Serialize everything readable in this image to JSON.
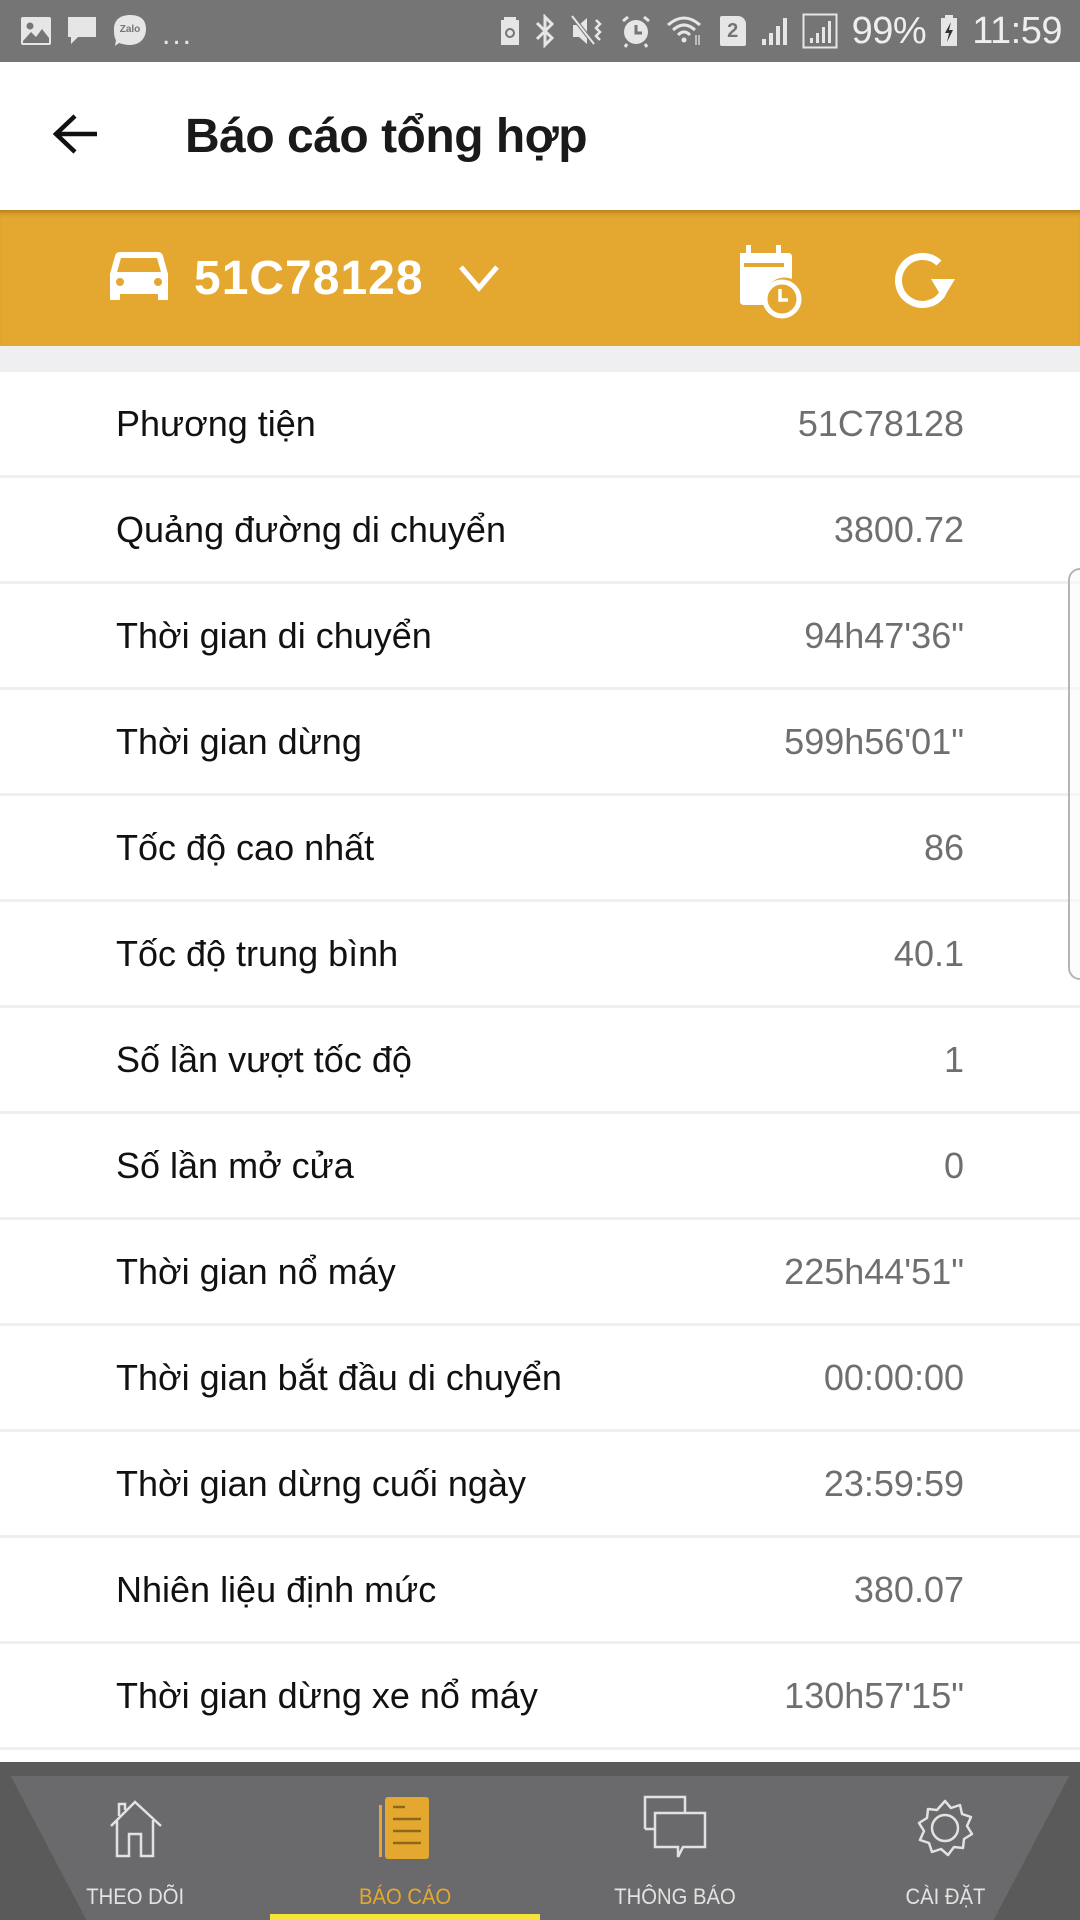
{
  "status_bar": {
    "left_icons": [
      "gallery-icon",
      "message-icon",
      "zalo-icon"
    ],
    "zalo_label": "Zalo",
    "more_indicator": "...",
    "right_icons": [
      "storage-icon",
      "bluetooth-icon",
      "vibrate-mute-icon",
      "alarm-icon",
      "wifi-icon",
      "sim2-icon",
      "signal-icon",
      "signal-icon-2"
    ],
    "sim_number": "2",
    "battery_percent": "99%",
    "time": "11:59"
  },
  "app_bar": {
    "back_icon": "arrow-left-icon",
    "title": "Báo cáo tổng hợp"
  },
  "vehicle_bar": {
    "vehicle_icon": "car-icon",
    "selected_vehicle": "51C78128",
    "dropdown_icon": "chevron-down-icon",
    "calendar_icon": "calendar-clock-icon",
    "refresh_icon": "refresh-icon",
    "accent_color": "#e4a830"
  },
  "report": {
    "rows": [
      {
        "label": "Phương tiện",
        "value": "51C78128"
      },
      {
        "label": "Quảng đường di chuyển",
        "value": "3800.72"
      },
      {
        "label": "Thời gian di chuyển",
        "value": "94h47'36\""
      },
      {
        "label": "Thời gian dừng",
        "value": "599h56'01\""
      },
      {
        "label": "Tốc độ cao nhất",
        "value": "86"
      },
      {
        "label": "Tốc độ trung bình",
        "value": "40.1"
      },
      {
        "label": "Số lần vượt tốc độ",
        "value": "1"
      },
      {
        "label": "Số lần mở cửa",
        "value": "0"
      },
      {
        "label": "Thời gian nổ máy",
        "value": "225h44'51\""
      },
      {
        "label": "Thời gian bắt đầu di chuyển",
        "value": "00:00:00"
      },
      {
        "label": "Thời gian dừng cuối ngày",
        "value": "23:59:59"
      },
      {
        "label": "Nhiên liệu định mức",
        "value": "380.07"
      },
      {
        "label": "Thời gian dừng xe nổ máy",
        "value": "130h57'15\""
      }
    ]
  },
  "bottom_nav": {
    "items": [
      {
        "label": "THEO DÕI",
        "icon": "home-icon",
        "active": false
      },
      {
        "label": "BÁO CÁO",
        "icon": "report-icon",
        "active": true
      },
      {
        "label": "THÔNG BÁO",
        "icon": "chat-icon",
        "active": false
      },
      {
        "label": "CÀI ĐẶT",
        "icon": "gear-icon",
        "active": false
      }
    ],
    "active_color": "#e4a830",
    "indicator_color": "#f8e33a"
  }
}
